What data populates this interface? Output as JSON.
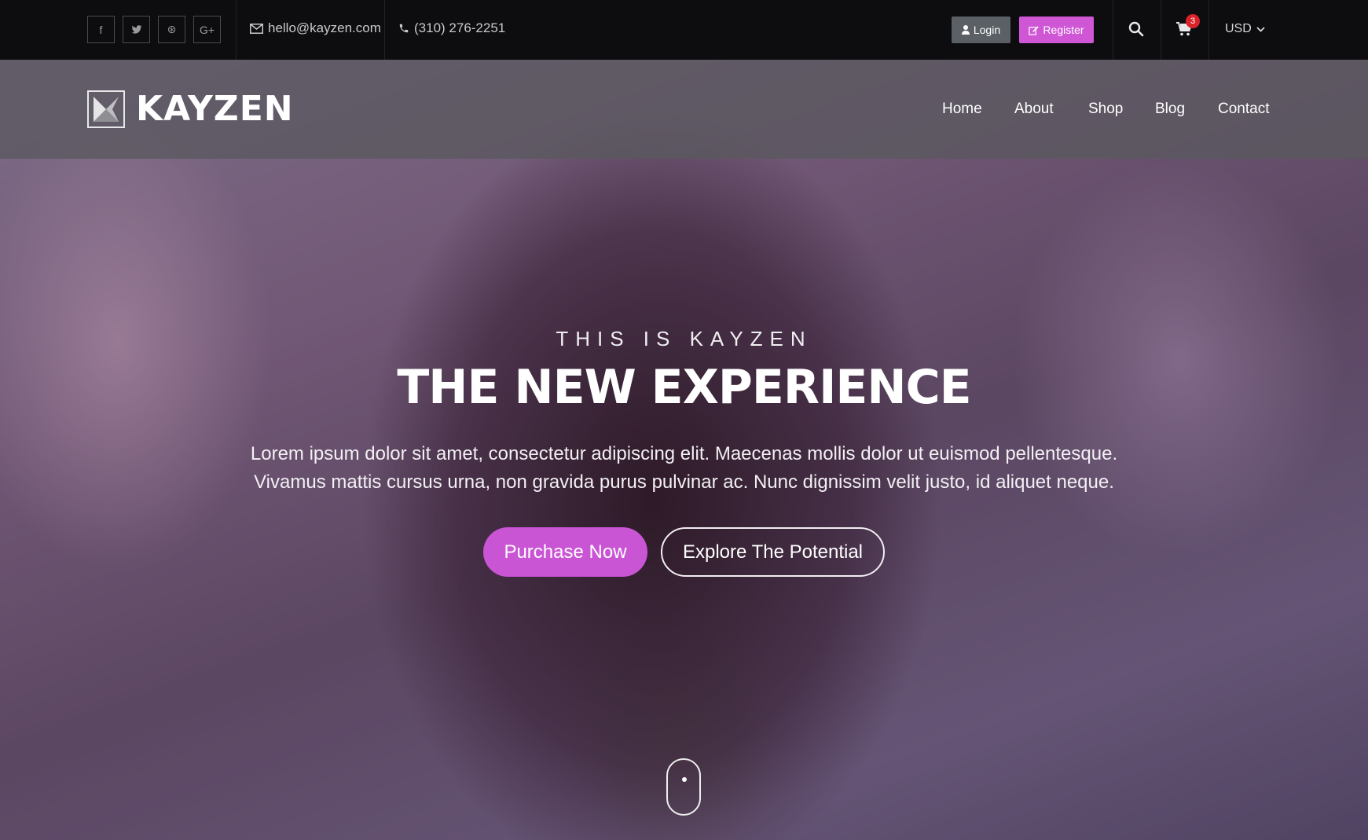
{
  "topbar": {
    "social_icons": [
      "facebook-icon",
      "twitter-icon",
      "dribbble-icon",
      "google-plus-icon"
    ],
    "social_glyphs": [
      "f",
      "t",
      "⊛",
      "G+"
    ],
    "email": "hello@kayzen.com",
    "phone": "(310) 276-2251",
    "login_label": "Login",
    "register_label": "Register",
    "cart_count": "3",
    "currency": "USD"
  },
  "header": {
    "logo_text": "KAYZEN",
    "nav": [
      "Home",
      "About",
      "Shop",
      "Blog",
      "Contact"
    ]
  },
  "hero": {
    "eyebrow": "THIS IS KAYZEN",
    "headline": "THE NEW EXPERIENCE",
    "description_line1": "Lorem ipsum dolor sit amet, consectetur adipiscing elit. Maecenas mollis dolor ut euismod pellentesque.",
    "description_line2": "Vivamus mattis cursus urna, non gravida purus pulvinar ac. Nunc dignissim velit justo, id aliquet neque.",
    "primary_cta": "Purchase Now",
    "secondary_cta": "Explore The Potential"
  },
  "colors": {
    "accent": "#cf57d6",
    "badge": "#d8232a",
    "topbar": "#0d0d0f"
  }
}
